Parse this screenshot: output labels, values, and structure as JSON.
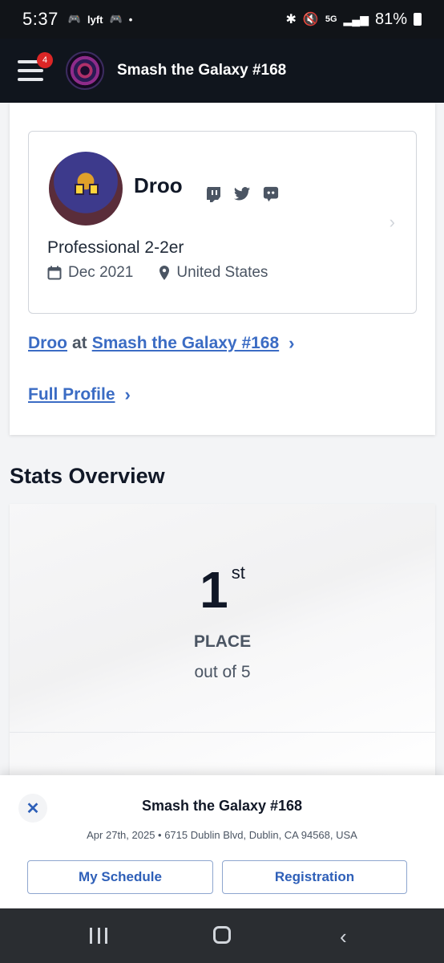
{
  "status_bar": {
    "time": "5:37",
    "battery": "81%",
    "network": "5G"
  },
  "header": {
    "title": "Smash the Galaxy #168",
    "notification_count": "4"
  },
  "profile": {
    "name": "Droo",
    "tagline": "Professional 2-2er",
    "joined": "Dec 2021",
    "location": "United States",
    "social_icons": [
      "twitch-icon",
      "twitter-icon",
      "discord-icon"
    ]
  },
  "links": {
    "player": "Droo",
    "at": "at",
    "event": "Smash the Galaxy #168",
    "full_profile": "Full Profile"
  },
  "stats": {
    "section_title": "Stats Overview",
    "place": "1",
    "suffix": "st",
    "place_label": "PLACE",
    "out_of": "out of 5"
  },
  "sheet": {
    "title": "Smash the Galaxy #168",
    "subtitle": "Apr 27th, 2025 • 6715 Dublin Blvd, Dublin, CA 94568, USA",
    "schedule_label": "My Schedule",
    "registration_label": "Registration"
  },
  "colors": {
    "link": "#3b6cc4",
    "header_bg": "#10151d",
    "accent_button": "#2e5fb8"
  }
}
